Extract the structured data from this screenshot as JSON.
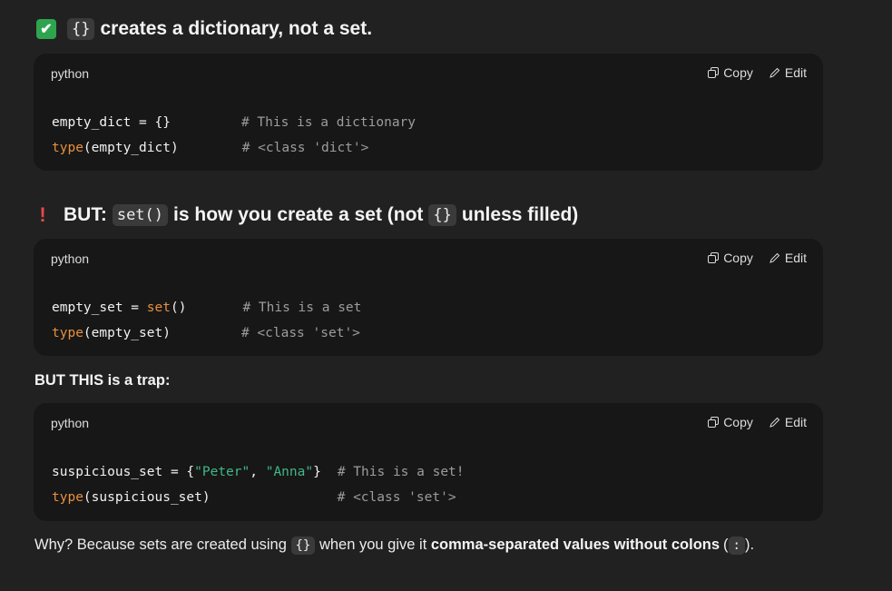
{
  "section1": {
    "heading_code": "{}",
    "heading_text": "creates a dictionary, not a set."
  },
  "code_labels": {
    "lang": "python",
    "copy": "Copy",
    "edit": "Edit"
  },
  "code1": {
    "line1_code": "empty_dict = {}",
    "line1_comment": "# This is a dictionary",
    "line2_kw": "type",
    "line2_rest": "(empty_dict)",
    "line2_comment": "# <class 'dict'>"
  },
  "section2": {
    "heading_prefix": "BUT:",
    "heading_code1": "set()",
    "heading_mid": "is how you create a set (not",
    "heading_code2": "{}",
    "heading_suffix": "unless filled)"
  },
  "code2": {
    "line1_var": "empty_set = ",
    "line1_kw": "set",
    "line1_rest": "()",
    "line1_comment": "# This is a set",
    "line2_kw": "type",
    "line2_rest": "(empty_set)",
    "line2_comment": "# <class 'set'>"
  },
  "trap_text": "BUT THIS is a trap:",
  "code3": {
    "line1_var": "suspicious_set = {",
    "line1_str1": "\"Peter\"",
    "line1_sep": ", ",
    "line1_str2": "\"Anna\"",
    "line1_close": "}",
    "line1_comment": "# This is a set!",
    "line2_kw": "type",
    "line2_rest": "(suspicious_set)",
    "line2_comment": "# <class 'set'>"
  },
  "why": {
    "part1": "Why? Because sets are created using",
    "code1": "{}",
    "part2": "when you give it",
    "bold": "comma-separated values without colons",
    "part3": "(",
    "code2": ":",
    "part4": ")."
  }
}
